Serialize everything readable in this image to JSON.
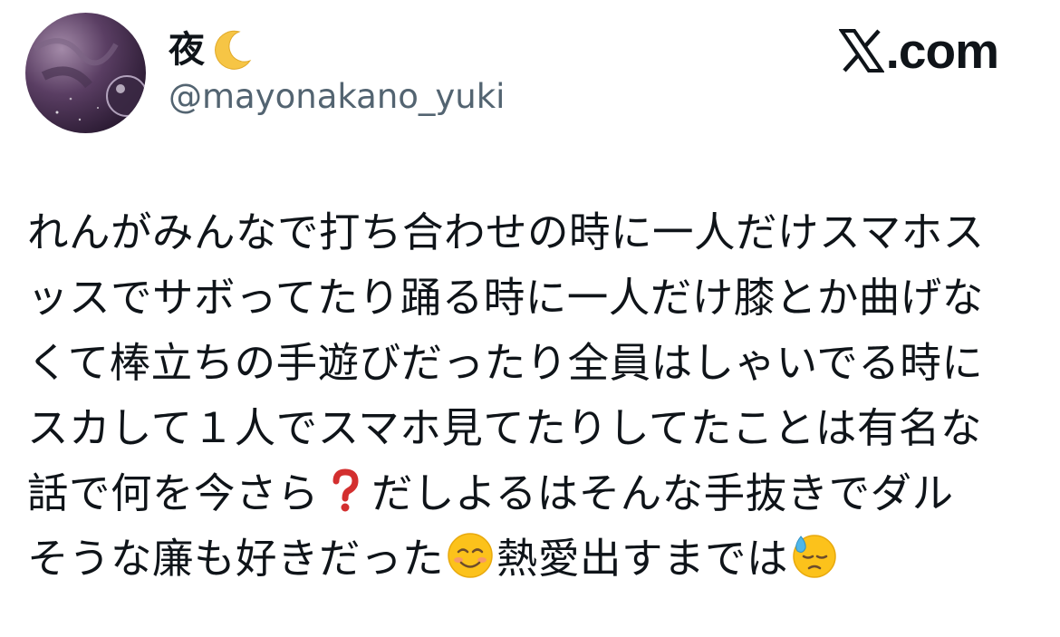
{
  "author": {
    "display_name": "夜",
    "name_emoji": "crescent-moon-icon",
    "handle": "@mayonakano_yuki"
  },
  "brand": {
    "icon": "x-logo-icon",
    "text": ".com"
  },
  "tweet": {
    "lines": [
      [
        "れんがみんなで打ち合わせの時に一人だけスマホス"
      ],
      [
        "ッスでサボってたり踊る時に一人だけ膝とか曲げな"
      ],
      [
        "くて棒立ちの手遊びだったり全員はしゃいでる時に"
      ],
      [
        "スカして１人でスマホ見てたりしてたことは有名な"
      ],
      [
        "話で何を今さら",
        "❓",
        "だしよるはそんな手抜きでダル"
      ],
      [
        "そうな廉も好きだった",
        "☺",
        "熱愛出すまでは",
        "😓"
      ]
    ]
  },
  "colors": {
    "text": "#0f1419",
    "handle": "#536471",
    "question_mark": "#d32f2f"
  }
}
